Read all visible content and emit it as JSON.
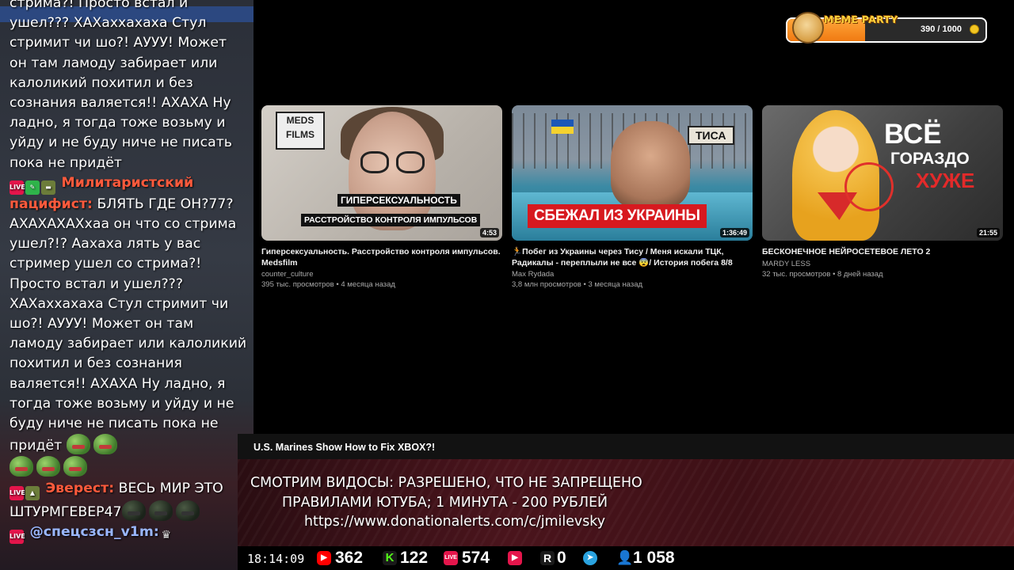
{
  "chat": {
    "messages": [
      {
        "lines": "стрима?! Просто встал и ушел??? ХАХаххахаха Стул стримит чи шо?! АУУУ! Может он там ламоду забирает или калоликий похитил и без сознания валяется!! АХАХА Ну ладно, я тогда тоже возьму и уйду и не буду ниче не писать пока не придёт"
      },
      {
        "user": "Милитаристский пацифист:",
        "text": " БЛЯТЬ ГДЕ ОН?77? АХАХАХАХхаа он что со стрима ушел?!? Аахаха лять у вас стример ушел со стрима?! Просто встал и ушел??? ХАХаххахаха Стул стримит чи шо?! АУУУ! Может он там ламоду забирает или калоликий похитил и без сознания валяется!! АХАХА Ну ладно, я тогда тоже возьму и уйду и не буду ниче не писать пока не придёт"
      },
      {
        "user": "Эверест:",
        "text": " ВЕСЬ МИР ЭТО ШТУРМГЕВЕР47"
      },
      {
        "user": "@спецсзсн_v1m:",
        "text": ""
      }
    ],
    "user_colors": {
      "militarist": "#ff5a3c",
      "everest": "#ff5a3c",
      "next": "#9ab7ff"
    }
  },
  "meme_party": {
    "title": "MEME PARTY",
    "value": "390 / 1000",
    "progress": 0.39,
    "icon": "doge-icon",
    "coin_icon": "coin-icon"
  },
  "videos": [
    {
      "title": "Гиперсексуальность. Расстройство контроля импульсов. Medsfilm",
      "channel": "counter_culture",
      "meta": "395 тыс. просмотров • 4 месяца назад",
      "duration": "4:53",
      "thumb_text": [
        "MEDS FILMS",
        "ГИПЕРСЕКСУАЛЬНОСТЬ",
        "РАССТРОЙСТВО КОНТРОЛЯ ИМПУЛЬСОВ"
      ]
    },
    {
      "title": "🏃Побег из Украины через Тису / Меня искали ТЦК, Радикалы - переплыли не все 😨/ История побега 8/8",
      "channel": "Max Rydada",
      "meta": "3,8 млн просмотров • 3 месяца назад",
      "duration": "1:36:49",
      "thumb_text": [
        "ТИСА",
        "СБЕЖАЛ ИЗ УКРАИНЫ"
      ]
    },
    {
      "title": "БЕСКОНЕЧНОЕ НЕЙРОСЕТЕВОЕ ЛЕТО 2",
      "channel": "MARDY LESS",
      "meta": "32 тыс. просмотров • 8 дней назад",
      "duration": "21:55",
      "thumb_text": [
        "ВСЁ",
        "ГОРАЗДО",
        "ХУЖЕ"
      ]
    }
  ],
  "now_playing_title": "U.S. Marines Show How to Fix XBOX?!",
  "rules": {
    "line1": "СМОТРИМ ВИДОСЫ: РАЗРЕШЕНО, ЧТО НЕ ЗАПРЕЩЕНО",
    "line2": "ПРАВИЛАМИ ЮТУБА; 1 МИНУТА - 200 РУБЛЕЙ",
    "line3": "https://www.donationalerts.com/c/jmilevsky"
  },
  "stats": {
    "clock": "18:14:09",
    "items": [
      {
        "icon": "youtube-icon",
        "value": "362",
        "color": "#ff0000"
      },
      {
        "icon": "kick-icon",
        "value": "122",
        "color": "#53fc18"
      },
      {
        "icon": "vk-live-icon",
        "value": "574",
        "color": "#e4154b"
      },
      {
        "icon": "rutube-play-icon",
        "value": "",
        "color": "#e4154b"
      },
      {
        "icon": "rutube-icon",
        "value": "0",
        "color": "#1a1a1a"
      },
      {
        "icon": "telegram-icon",
        "value": "",
        "color": "#2aa3e0"
      },
      {
        "icon": "viewers-icon",
        "value": "1 058",
        "color": "#3b82f6"
      }
    ]
  }
}
